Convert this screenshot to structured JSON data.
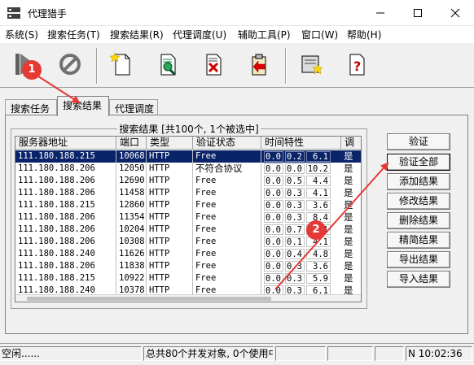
{
  "window": {
    "title": "代理猎手"
  },
  "menu": [
    "系统(S)",
    "搜索任务(T)",
    "搜索结果(R)",
    "代理调度(U)",
    "辅助工具(P)",
    "窗口(W)",
    "帮助(H)"
  ],
  "toolbar": {
    "icons": [
      "play-icon",
      "stop-icon",
      "new-document-icon",
      "search-document-icon",
      "delete-document-icon",
      "import-icon",
      "settings-icon",
      "help-icon"
    ]
  },
  "tabs": [
    "搜索任务",
    "搜索结果",
    "代理调度"
  ],
  "results": {
    "group_title": "搜索结果 [共100个, 1个被选中]",
    "columns": [
      "服务器地址",
      "端口",
      "类型",
      "验证状态",
      "时间特性",
      "调"
    ],
    "rows": [
      {
        "ip": "111.180.188.215",
        "port": "10068",
        "type": "HTTP",
        "status": "Free",
        "t1": "0.0",
        "t2": "0.2",
        "t3": "6.1",
        "flag": "是"
      },
      {
        "ip": "111.180.188.206",
        "port": "12050",
        "type": "HTTP",
        "status": "不符合协议",
        "t1": "0.0",
        "t2": "0.0",
        "t3": "10.2",
        "flag": "是"
      },
      {
        "ip": "111.180.188.206",
        "port": "12690",
        "type": "HTTP",
        "status": "Free",
        "t1": "0.0",
        "t2": "0.5",
        "t3": "4.4",
        "flag": "是"
      },
      {
        "ip": "111.180.188.206",
        "port": "11458",
        "type": "HTTP",
        "status": "Free",
        "t1": "0.0",
        "t2": "0.3",
        "t3": "4.1",
        "flag": "是"
      },
      {
        "ip": "111.180.188.215",
        "port": "12860",
        "type": "HTTP",
        "status": "Free",
        "t1": "0.0",
        "t2": "0.3",
        "t3": "3.6",
        "flag": "是"
      },
      {
        "ip": "111.180.188.206",
        "port": "11354",
        "type": "HTTP",
        "status": "Free",
        "t1": "0.0",
        "t2": "0.3",
        "t3": "8.4",
        "flag": "是"
      },
      {
        "ip": "111.180.188.206",
        "port": "10204",
        "type": "HTTP",
        "status": "Free",
        "t1": "0.0",
        "t2": "0.7",
        "t3": "4.1",
        "flag": "是"
      },
      {
        "ip": "111.180.188.206",
        "port": "10308",
        "type": "HTTP",
        "status": "Free",
        "t1": "0.0",
        "t2": "0.1",
        "t3": "4.1",
        "flag": "是"
      },
      {
        "ip": "111.180.188.240",
        "port": "11626",
        "type": "HTTP",
        "status": "Free",
        "t1": "0.0",
        "t2": "0.4",
        "t3": "4.8",
        "flag": "是"
      },
      {
        "ip": "111.180.188.206",
        "port": "11838",
        "type": "HTTP",
        "status": "Free",
        "t1": "0.0",
        "t2": "0.3",
        "t3": "3.6",
        "flag": "是"
      },
      {
        "ip": "111.180.188.215",
        "port": "10922",
        "type": "HTTP",
        "status": "Free",
        "t1": "0.0",
        "t2": "0.3",
        "t3": "5.9",
        "flag": "是"
      },
      {
        "ip": "111.180.188.240",
        "port": "10378",
        "type": "HTTP",
        "status": "Free",
        "t1": "0.0",
        "t2": "0.3",
        "t3": "6.1",
        "flag": "是"
      },
      {
        "ip": "111.180.188.240",
        "port": "10692",
        "type": "HTTP",
        "status": "Free",
        "t1": "0.0",
        "t2": "0.3",
        "t3": "4.1",
        "flag": "是"
      }
    ],
    "selected_index": 0
  },
  "side_buttons": [
    "验证",
    "验证全部",
    "添加结果",
    "修改结果",
    "删除结果",
    "精简结果",
    "导出结果",
    "导入结果"
  ],
  "statusbar": {
    "left": "空闲......",
    "middle": "总共80个并发对象, 0个使用中",
    "right": "N 10:02:36"
  },
  "annotations": [
    "1",
    "2"
  ],
  "colors": {
    "selection": "#0a246a",
    "annotation": "#e53935"
  }
}
